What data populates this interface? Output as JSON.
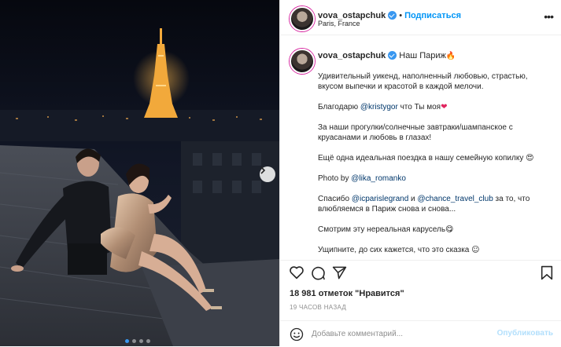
{
  "header": {
    "username": "vova_ostapchuk",
    "separator": "•",
    "follow_label": "Подписаться",
    "location": "Paris, France",
    "more_label": "•••"
  },
  "caption": {
    "username": "vova_ostapchuk",
    "title": "Наш Париж",
    "title_emoji": "🔥",
    "lines": {
      "p1": "Удивительный уикенд, наполненный любовью, страстью, вкусом выпечки и красотой в каждой мелочи.",
      "p2_prefix": "Благодарю ",
      "p2_mention": "@kristygor",
      "p2_suffix": " что Ты моя",
      "p2_emoji": "❤",
      "p3": "За наши прогулки/солнечные завтраки/шампанское с круасанами и любовь в глазах!",
      "p4": "Ещё одна идеальная поездка в нашу семейную копилку",
      "p4_emoji": "😍",
      "p5_prefix": "Photo by ",
      "p5_mention": "@lika_romanko",
      "p6_prefix": "Спасибо ",
      "p6_mention1": "@icparislegrand",
      "p6_and": " и ",
      "p6_mention2": "@chance_travel_club",
      "p6_suffix": " за то, что влюбляемся в Париж снова и снова...",
      "p7": "Смотрим эту нереальная карусель",
      "p7_emoji": "😋",
      "p8": "Ущипните, до сих кажется, что это сказка",
      "p8_emoji": "☺"
    }
  },
  "stats": {
    "likes": "18 981 отметок \"Нравится\"",
    "time": "19 часов назад"
  },
  "comment": {
    "placeholder": "Добавьте комментарий...",
    "publish_label": "Опубликовать"
  },
  "carousel": {
    "slide_count": 4,
    "active_index": 0
  },
  "colors": {
    "accent": "#0095f6",
    "verified": "#3897f0",
    "mention": "#00376b",
    "muted": "#8e8e8e"
  }
}
